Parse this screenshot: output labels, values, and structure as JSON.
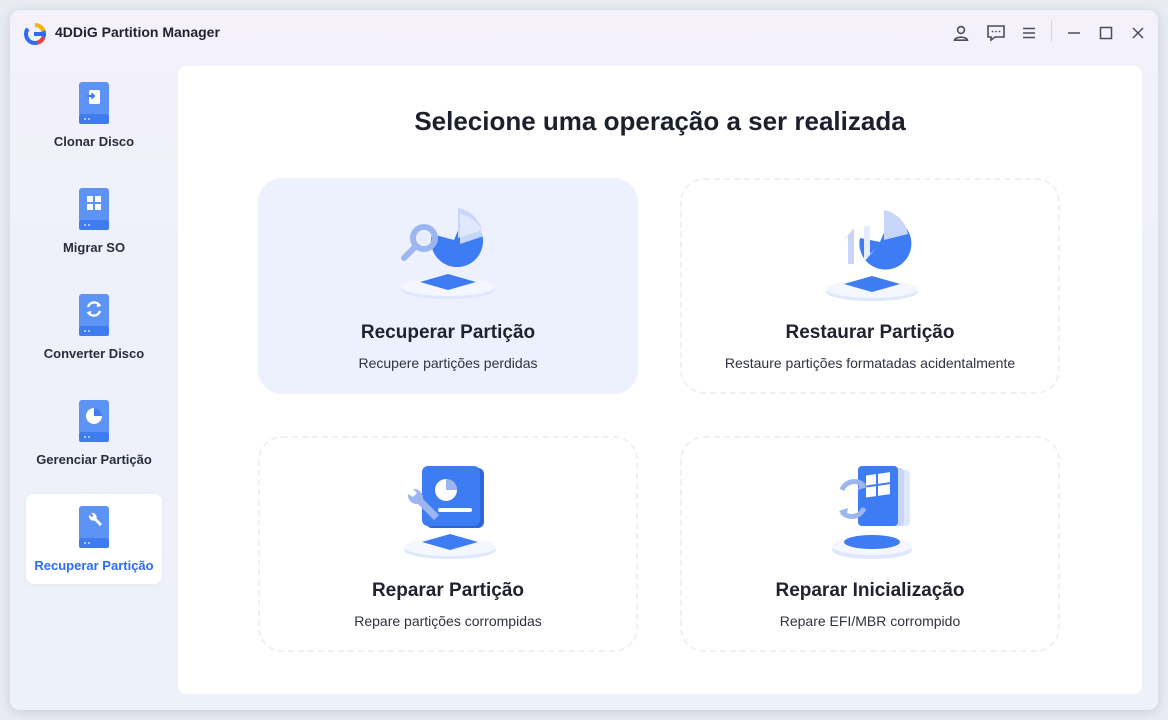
{
  "app": {
    "title": "4DDiG Partition Manager"
  },
  "sidebar": {
    "items": [
      {
        "label": "Clonar Disco",
        "icon": "clone-disk-icon"
      },
      {
        "label": "Migrar SO",
        "icon": "windows-os-icon"
      },
      {
        "label": "Converter Disco",
        "icon": "convert-disk-icon"
      },
      {
        "label": "Gerenciar Partição",
        "icon": "pie-partition-icon"
      },
      {
        "label": "Recuperar Partição",
        "icon": "wrench-icon",
        "active": true
      }
    ]
  },
  "main": {
    "title": "Selecione uma operação a ser realizada",
    "cards": [
      {
        "title": "Recuperar Partição",
        "desc": "Recupere partições perdidas",
        "icon": "recover-partition-icon",
        "selected": true
      },
      {
        "title": "Restaurar Partição",
        "desc": "Restaure partições formatadas acidentalmente",
        "icon": "restore-partition-icon"
      },
      {
        "title": "Reparar Partição",
        "desc": "Repare partições corrompidas",
        "icon": "repair-partition-icon"
      },
      {
        "title": "Reparar Inicialização",
        "desc": "Repare EFI/MBR corrompido",
        "icon": "repair-boot-icon"
      }
    ]
  },
  "colors": {
    "accent": "#2c6cf6",
    "selected_card": "#edf1fd",
    "icon_blue": "#3d7cf2"
  }
}
